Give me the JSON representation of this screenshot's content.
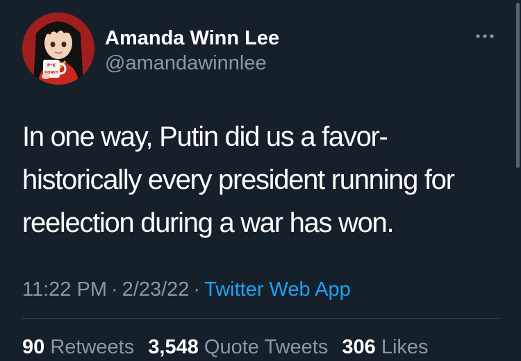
{
  "author": {
    "name": "Amanda Winn Lee",
    "handle": "@amandawinnlee"
  },
  "avatar": {
    "description_icon": "avatar-anime-character-with-mug",
    "mug_text_top": "P*K",
    "mug_text_bottom": "HONKY",
    "background_color": "#a11e1e"
  },
  "more_icon": "more-horizontal-icon",
  "tweet": {
    "lines": [
      "In one way, Putin did us a favor-",
      "historically every president running for",
      "reelection during a war has won."
    ]
  },
  "meta": {
    "time": "11:22 PM",
    "date": "2/23/22",
    "separator": "·",
    "source": "Twitter Web App"
  },
  "stats": {
    "retweets_count": "90",
    "retweets_label": "Retweets",
    "quotes_count": "3,548",
    "quotes_label": "Quote Tweets",
    "likes_count": "306",
    "likes_label": "Likes"
  },
  "colors": {
    "background": "#15202b",
    "primary_text": "#ffffff",
    "secondary_text": "#8899a6",
    "link": "#1da1f2",
    "divider": "#38444d"
  }
}
